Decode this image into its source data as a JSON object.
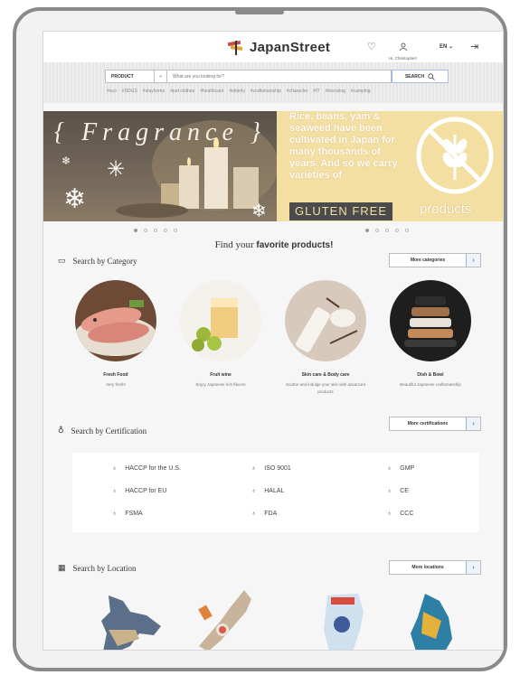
{
  "header": {
    "logo_text": "JapanStreet",
    "user_name": "Hi, Christopher!",
    "language": "EN"
  },
  "search": {
    "category": "PRODUCT",
    "placeholder": "What are you looking for?",
    "button_label": "SEARCH",
    "tags": [
      "#eco",
      "#SDGS",
      "#stayhome",
      "#pet clothes",
      "#healthcare",
      "#elderly",
      "#craftsmanship",
      "#character",
      "#IT",
      "#licensing",
      "#camping"
    ]
  },
  "hero": {
    "left_title": "{ Fragrance }",
    "right_copy": "Rice, beans, yam & seaweed have been cultivated in Japan for many thousands of years. And so we carry varieties of",
    "gluten_badge": "GLUTEN FREE",
    "products_word": "products"
  },
  "headline": {
    "prefix": "Find your ",
    "emphasis": "favorite products!"
  },
  "categories_section": {
    "title": "Search by Category",
    "more_label": "More categories",
    "items": [
      {
        "name": "Fresh Food",
        "desc": "Very fresh!"
      },
      {
        "name": "Fruit wine",
        "desc": "Enjoy Japanese rich flavors"
      },
      {
        "name": "Skin care & Body care",
        "desc": "Soothe and indulge your skin with advanced products"
      },
      {
        "name": "Dish & Bowl",
        "desc": "Beautiful Japanese craftsmanship"
      }
    ]
  },
  "certification_section": {
    "title": "Search by Certification",
    "more_label": "More certifications",
    "items": [
      "HACCP for the U.S.",
      "ISO 9001",
      "GMP",
      "HACCP for EU",
      "HALAL",
      "CE",
      "FSMA",
      "FDA",
      "CCC"
    ]
  },
  "location_section": {
    "title": "Search by Location",
    "more_label": "More locations"
  }
}
